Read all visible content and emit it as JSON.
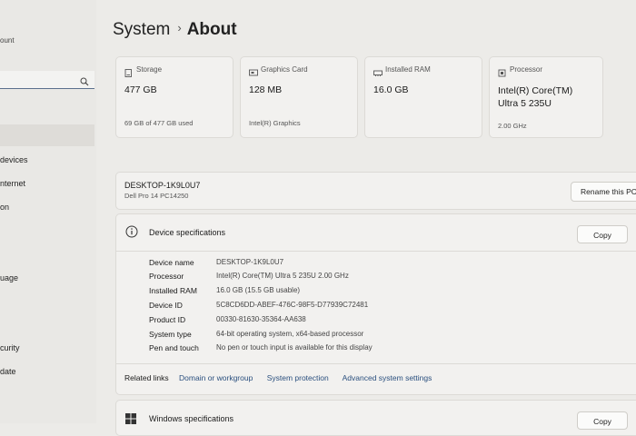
{
  "sidebar": {
    "account_fragment": "ount",
    "search_icon": "search-icon",
    "items": [
      "devices",
      "nternet",
      "on",
      "uage",
      "curity",
      "date"
    ]
  },
  "breadcrumb": {
    "parent": "System",
    "separator": "›",
    "current": "About"
  },
  "cards": [
    {
      "icon": "storage-icon",
      "title": "Storage",
      "value": "477 GB",
      "sub": "69 GB of 477 GB used"
    },
    {
      "icon": "graphics-card-icon",
      "title": "Graphics Card",
      "value": "128 MB",
      "sub": "Intel(R) Graphics"
    },
    {
      "icon": "ram-icon",
      "title": "Installed RAM",
      "value": "16.0 GB",
      "sub": ""
    },
    {
      "icon": "processor-icon",
      "title": "Processor",
      "value_line1": "Intel(R) Core(TM)",
      "value_line2": "Ultra 5 235U",
      "sub": "2.00 GHz"
    }
  ],
  "pc": {
    "name": "DESKTOP-1K9L0U7",
    "model": "Dell Pro 14 PC14250",
    "rename_label": "Rename this PC"
  },
  "device_specs": {
    "title": "Device specifications",
    "copy_label": "Copy",
    "rows": [
      {
        "label": "Device name",
        "value": "DESKTOP-1K9L0U7"
      },
      {
        "label": "Processor",
        "value": "Intel(R) Core(TM) Ultra 5 235U   2.00 GHz"
      },
      {
        "label": "Installed RAM",
        "value": "16.0 GB (15.5 GB usable)"
      },
      {
        "label": "Device ID",
        "value": "5C8CD6DD-ABEF-476C-98F5-D77939C72481"
      },
      {
        "label": "Product ID",
        "value": "00330-81630-35364-AA638"
      },
      {
        "label": "System type",
        "value": "64-bit operating system, x64-based processor"
      },
      {
        "label": "Pen and touch",
        "value": "No pen or touch input is available for this display"
      }
    ]
  },
  "related_links": {
    "label": "Related links",
    "links": [
      "Domain or workgroup",
      "System protection",
      "Advanced system settings"
    ]
  },
  "windows_specs": {
    "title": "Windows specifications",
    "copy_label": "Copy",
    "icon": "windows-logo-icon"
  },
  "colors": {
    "background": "#ecebe8",
    "card": "#f2f1ef",
    "link": "#2a4f7e",
    "search_underline": "#5a6f8c"
  }
}
